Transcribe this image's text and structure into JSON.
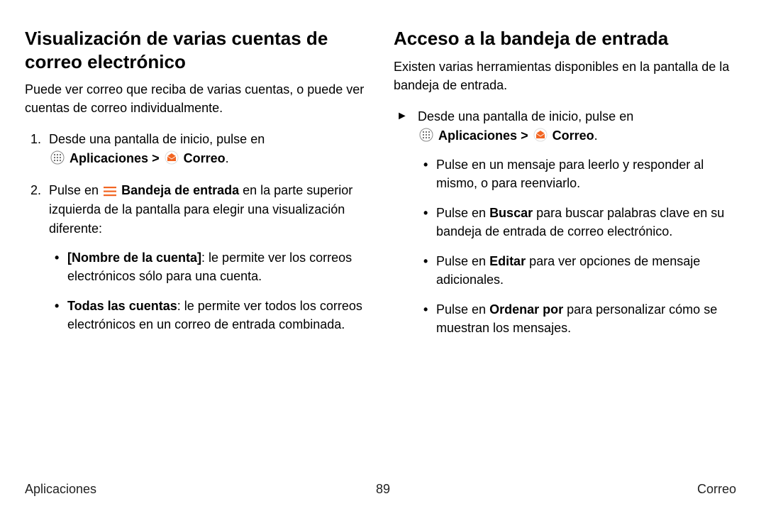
{
  "left": {
    "heading": "Visualización de varias cuentas de correo electrónico",
    "intro": "Puede ver correo que reciba de varias cuentas, o puede ver cuentas de correo individualmente.",
    "step1_text": "Desde una pantalla de inicio, pulse en ",
    "apps_label": "Aplicaciones",
    "gt": " > ",
    "correo_label": "Correo",
    "period": ".",
    "step2_pre": "Pulse en ",
    "step2_bandeja": "Bandeja de entrada",
    "step2_post": " en la parte superior izquierda de la pantalla para elegir una visualización diferente:",
    "bullet_a_bold": "[Nombre de la cuenta]",
    "bullet_a_text": ": le permite ver los correos electrónicos sólo para una cuenta.",
    "bullet_b_bold": "Todas las cuentas",
    "bullet_b_text": ": le permite ver todos los correos electrónicos en un correo de entrada combinada."
  },
  "right": {
    "heading": "Acceso a la bandeja de entrada",
    "intro": "Existen varias herramientas disponibles en la pantalla de la bandeja de entrada.",
    "lead_text": "Desde una pantalla de inicio, pulse en ",
    "apps_label": "Aplicaciones",
    "gt": " > ",
    "correo_label": "Correo",
    "period": ".",
    "b1": "Pulse en un mensaje para leerlo y responder al mismo, o para reenviarlo.",
    "b2_pre": "Pulse en ",
    "b2_bold": "Buscar",
    "b2_post": " para buscar palabras clave en su bandeja de entrada de correo electrónico.",
    "b3_pre": "Pulse en ",
    "b3_bold": "Editar",
    "b3_post": " para ver opciones de mensaje adicionales.",
    "b4_pre": "Pulse en ",
    "b4_bold": "Ordenar por",
    "b4_post": " para personalizar cómo se muestran los mensajes."
  },
  "footer": {
    "left": "Aplicaciones",
    "center": "89",
    "right": "Correo"
  },
  "nums": {
    "one": "1.",
    "two": "2."
  },
  "arrow": "►"
}
